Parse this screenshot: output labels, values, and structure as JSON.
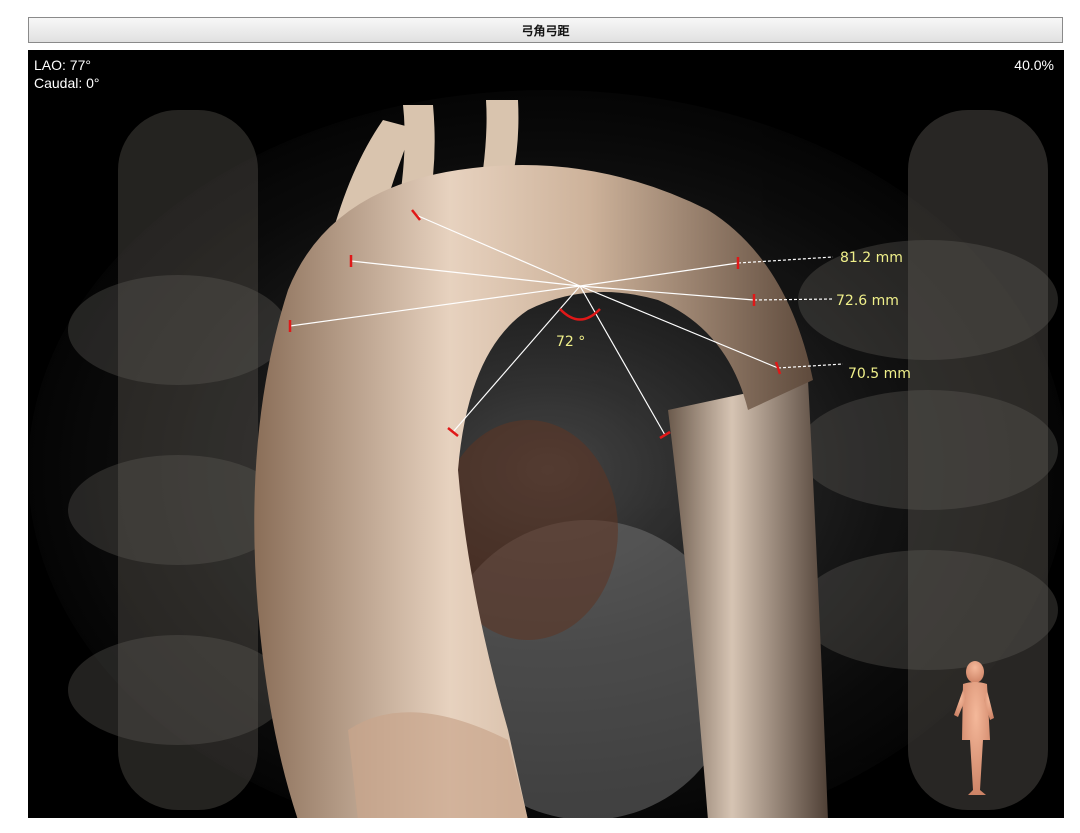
{
  "window": {
    "title": "弓角弓距"
  },
  "overlay": {
    "view_angle_primary": "LAO: 77°",
    "view_angle_secondary": "Caudal: 0°",
    "zoom": "40.0%"
  },
  "measurements": {
    "distance_1": "81.2 mm",
    "distance_2": "72.6 mm",
    "distance_3": "70.5 mm",
    "angle": "72 °"
  },
  "colors": {
    "measure_line": "#ffffff",
    "endpoint_marker": "#e01818",
    "label_text": "#f0f08a",
    "background": "#000000"
  },
  "icons": {
    "orientation": "human-figure-icon"
  }
}
